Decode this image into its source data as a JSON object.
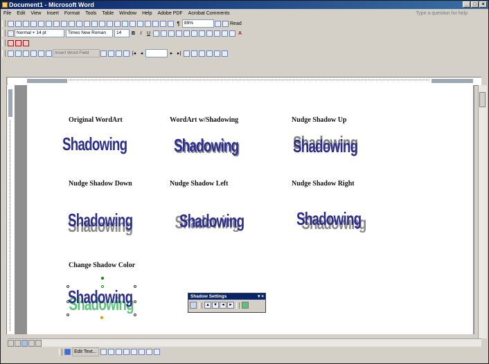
{
  "window": {
    "title": "Document1 - Microsoft Word",
    "min": "_",
    "max": "□",
    "close": "×"
  },
  "menu": [
    "File",
    "Edit",
    "View",
    "Insert",
    "Format",
    "Tools",
    "Table",
    "Window",
    "Help",
    "Adobe PDF",
    "Acrobat Comments"
  ],
  "help_placeholder": "Type a question for help",
  "toolbar": {
    "zoom": "89%",
    "read_label": "Read",
    "style_value": "Normal + 14 pt",
    "font_value": "Times New Roman",
    "size_value": "14",
    "insert_field": "Insert Word Field"
  },
  "labels": {
    "original": "Original WordArt",
    "shadowing": "WordArt w/Shadowing",
    "up": "Nudge Shadow Up",
    "down": "Nudge Shadow Down",
    "left": "Nudge Shadow Left",
    "right": "Nudge Shadow Right",
    "color": "Change Shadow Color"
  },
  "wordart_text": "Shadowing",
  "shadow_panel": {
    "title": "Shadow Settings",
    "close": "▾ ×"
  },
  "drawbar": {
    "edit_text": "Edit Text..."
  },
  "colors": {
    "wordart": "#2b2c8c",
    "shadow_gray": "#8c8c8c",
    "shadow_green": "#5ec27c",
    "title_bar": "#0a246a"
  },
  "icons": [
    "app-icon",
    "new-icon",
    "open-icon",
    "save-icon",
    "print-icon",
    "zoom-icon",
    "read-icon",
    "bold-icon",
    "italic-icon",
    "underline-icon",
    "align-icons",
    "bullets-icon",
    "font-color-icon",
    "shadow-toggle-icon",
    "nudge-up-icon",
    "nudge-down-icon",
    "nudge-left-icon",
    "nudge-right-icon",
    "shadow-color-icon"
  ]
}
